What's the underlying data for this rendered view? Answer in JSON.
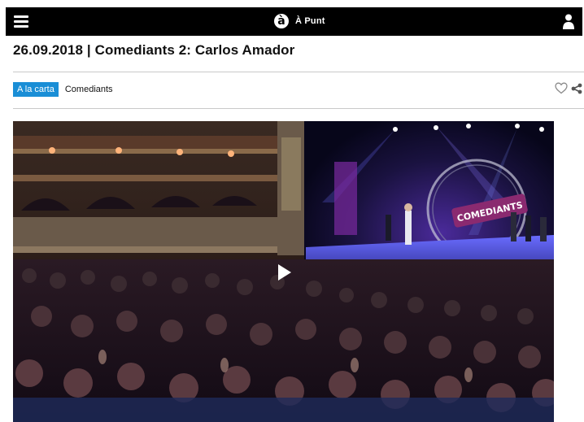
{
  "header": {
    "menu_icon": "hamburger-menu-icon",
    "brand_logo": "à",
    "brand_name": "À Punt",
    "user_icon": "user-icon"
  },
  "page": {
    "title": "26.09.2018 | Comediants 2: Carlos Amador"
  },
  "tags": {
    "primary": "A la carta",
    "secondary": "Comediants"
  },
  "actions": {
    "favorite_icon": "heart-outline-icon",
    "share_icon": "share-icon"
  },
  "video": {
    "play_icon": "play-icon",
    "stage_sign": "COMEDIANTS"
  },
  "colors": {
    "topbar": "#000000",
    "tag_primary": "#1a8ed6",
    "divider": "#c9c9c9",
    "stage_pink": "#d34fd6"
  }
}
